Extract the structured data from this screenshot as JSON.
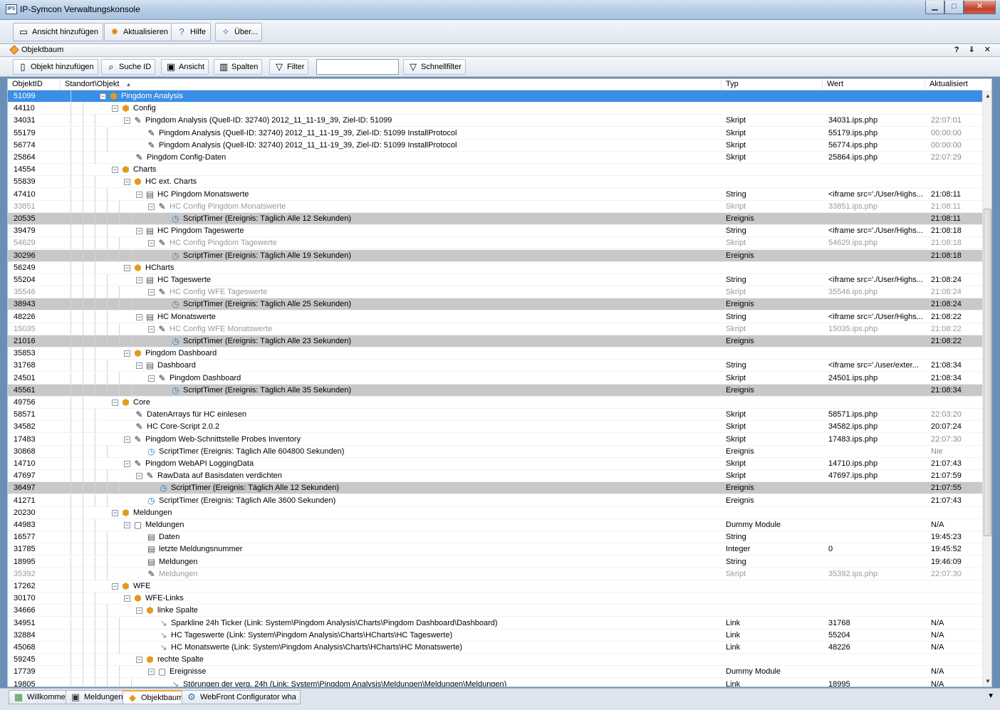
{
  "window": {
    "title": "IP-Symcon Verwaltungskonsole",
    "minimize": "▁",
    "maximize": "□",
    "close": "✕"
  },
  "main_toolbar": {
    "add_view": "Ansicht hinzufügen",
    "refresh": "Aktualisieren",
    "help": "Hilfe",
    "about": "Über..."
  },
  "panel": {
    "title": "Objektbaum",
    "controls": "? ⇓ ✕"
  },
  "tree_toolbar": {
    "add_object": "Objekt hinzufügen",
    "search_id": "Suche ID",
    "view": "Ansicht",
    "columns": "Spalten",
    "filter": "Filter",
    "filter_value": "",
    "quickfilter": "Schnellfilter"
  },
  "columns": {
    "id": "ObjektID",
    "name": "Standort\\Objekt",
    "sort_indicator": "▲",
    "type": "Typ",
    "value": "Wert",
    "updated": "Aktualisiert"
  },
  "rows": [
    {
      "id": "51099",
      "depth": 1,
      "toggle": "⊟",
      "icon": "category",
      "name": "Pingdom Analysis",
      "typ": "",
      "wert": "",
      "akt": "",
      "state": "selected"
    },
    {
      "id": "44110",
      "depth": 2,
      "toggle": "⊟",
      "icon": "category",
      "name": "Config",
      "typ": "",
      "wert": "",
      "akt": ""
    },
    {
      "id": "34031",
      "depth": 3,
      "toggle": "⊟",
      "icon": "script",
      "name": "Pingdom Analysis (Quell-ID: 32740) 2012_11_11-19_39, Ziel-ID: 51099",
      "typ": "Skript",
      "wert": "34031.ips.php",
      "akt": "22:07:01",
      "akt_grey": true
    },
    {
      "id": "55179",
      "depth": 4,
      "toggle": "",
      "icon": "script",
      "name": "Pingdom Analysis (Quell-ID: 32740) 2012_11_11-19_39, Ziel-ID: 51099 InstallProtocol",
      "typ": "Skript",
      "wert": "55179.ips.php",
      "akt": "00:00:00",
      "akt_grey": true
    },
    {
      "id": "56774",
      "depth": 4,
      "toggle": "",
      "icon": "script",
      "name": "Pingdom Analysis (Quell-ID: 32740) 2012_11_11-19_39, Ziel-ID: 51099 InstallProtocol",
      "typ": "Skript",
      "wert": "56774.ips.php",
      "akt": "00:00:00",
      "akt_grey": true
    },
    {
      "id": "25864",
      "depth": 3,
      "toggle": "",
      "icon": "script",
      "name": "Pingdom Config-Daten",
      "typ": "Skript",
      "wert": "25864.ips.php",
      "akt": "22:07:29",
      "akt_grey": true
    },
    {
      "id": "14554",
      "depth": 2,
      "toggle": "⊟",
      "icon": "category",
      "name": "Charts",
      "typ": "",
      "wert": "",
      "akt": ""
    },
    {
      "id": "55839",
      "depth": 3,
      "toggle": "⊟",
      "icon": "category",
      "name": "HC ext. Charts",
      "typ": "",
      "wert": "",
      "akt": ""
    },
    {
      "id": "47410",
      "depth": 4,
      "toggle": "⊟",
      "icon": "variable",
      "name": "HC Pingdom Monatswerte",
      "typ": "String",
      "wert": "<iframe src='./User/Highs...",
      "akt": "21:08:11"
    },
    {
      "id": "33851",
      "depth": 5,
      "toggle": "⊟",
      "icon": "script",
      "name": "HC Config Pingdom Monatswerte",
      "typ": "Skript",
      "wert": "33851.ips.php",
      "akt": "21:08:11",
      "state": "dim"
    },
    {
      "id": "20535",
      "depth": 6,
      "toggle": "",
      "icon": "event",
      "name": "ScriptTimer  (Ereignis: Täglich Alle 12 Sekunden)",
      "typ": "Ereignis",
      "wert": "",
      "akt": "21:08:11",
      "state": "highlight"
    },
    {
      "id": "39479",
      "depth": 4,
      "toggle": "⊟",
      "icon": "variable",
      "name": "HC Pingdom Tageswerte",
      "typ": "String",
      "wert": "<iframe src='./User/Highs...",
      "akt": "21:08:18"
    },
    {
      "id": "54629",
      "depth": 5,
      "toggle": "⊟",
      "icon": "script",
      "name": "HC Config Pingdom Tagewerte",
      "typ": "Skript",
      "wert": "54629.ips.php",
      "akt": "21:08:18",
      "state": "dim"
    },
    {
      "id": "30296",
      "depth": 6,
      "toggle": "",
      "icon": "event",
      "name": "ScriptTimer  (Ereignis: Täglich Alle 19 Sekunden)",
      "typ": "Ereignis",
      "wert": "",
      "akt": "21:08:18",
      "state": "highlight"
    },
    {
      "id": "56249",
      "depth": 3,
      "toggle": "⊟",
      "icon": "category",
      "name": "HCharts",
      "typ": "",
      "wert": "",
      "akt": ""
    },
    {
      "id": "55204",
      "depth": 4,
      "toggle": "⊟",
      "icon": "variable",
      "name": "HC Tageswerte",
      "typ": "String",
      "wert": "<iframe src='./User/Highs...",
      "akt": "21:08:24"
    },
    {
      "id": "35546",
      "depth": 5,
      "toggle": "⊟",
      "icon": "script",
      "name": "HC Config WFE Tageswerte",
      "typ": "Skript",
      "wert": "35546.ips.php",
      "akt": "21:08:24",
      "state": "dim"
    },
    {
      "id": "38943",
      "depth": 6,
      "toggle": "",
      "icon": "event",
      "name": "ScriptTimer  (Ereignis: Täglich Alle 25 Sekunden)",
      "typ": "Ereignis",
      "wert": "",
      "akt": "21:08:24",
      "state": "highlight"
    },
    {
      "id": "48226",
      "depth": 4,
      "toggle": "⊟",
      "icon": "variable",
      "name": "HC Monatswerte",
      "typ": "String",
      "wert": "<iframe src='./User/Highs...",
      "akt": "21:08:22"
    },
    {
      "id": "15035",
      "depth": 5,
      "toggle": "⊟",
      "icon": "script",
      "name": "HC Config WFE Monatswerte",
      "typ": "Skript",
      "wert": "15035.ips.php",
      "akt": "21:08:22",
      "state": "dim"
    },
    {
      "id": "21016",
      "depth": 6,
      "toggle": "",
      "icon": "event",
      "name": "ScriptTimer  (Ereignis: Täglich Alle 23 Sekunden)",
      "typ": "Ereignis",
      "wert": "",
      "akt": "21:08:22",
      "state": "highlight"
    },
    {
      "id": "35853",
      "depth": 3,
      "toggle": "⊟",
      "icon": "category",
      "name": "Pingdom Dashboard",
      "typ": "",
      "wert": "",
      "akt": ""
    },
    {
      "id": "31768",
      "depth": 4,
      "toggle": "⊟",
      "icon": "variable",
      "name": "Dashboard",
      "typ": "String",
      "wert": "<iframe src='./user/exter...",
      "akt": "21:08:34"
    },
    {
      "id": "24501",
      "depth": 5,
      "toggle": "⊟",
      "icon": "script",
      "name": "Pingdom Dashboard",
      "typ": "Skript",
      "wert": "24501.ips.php",
      "akt": "21:08:34"
    },
    {
      "id": "45561",
      "depth": 6,
      "toggle": "",
      "icon": "event",
      "name": "ScriptTimer  (Ereignis: Täglich Alle 35 Sekunden)",
      "typ": "Ereignis",
      "wert": "",
      "akt": "21:08:34",
      "state": "highlight"
    },
    {
      "id": "49756",
      "depth": 2,
      "toggle": "⊟",
      "icon": "category",
      "name": "Core",
      "typ": "",
      "wert": "",
      "akt": ""
    },
    {
      "id": "58571",
      "depth": 3,
      "toggle": "",
      "icon": "script",
      "name": "DatenArrays für HC einlesen",
      "typ": "Skript",
      "wert": "58571.ips.php",
      "akt": "22:03:20",
      "akt_grey": true
    },
    {
      "id": "34582",
      "depth": 3,
      "toggle": "",
      "icon": "script",
      "name": "HC Core-Script 2.0.2",
      "typ": "Skript",
      "wert": "34582.ips.php",
      "akt": "20:07:24"
    },
    {
      "id": "17483",
      "depth": 3,
      "toggle": "⊟",
      "icon": "script",
      "name": "Pingdom Web-Schnittstelle Probes Inventory",
      "typ": "Skript",
      "wert": "17483.ips.php",
      "akt": "22:07:30",
      "akt_grey": true
    },
    {
      "id": "30868",
      "depth": 4,
      "toggle": "",
      "icon": "event",
      "name": "ScriptTimer  (Ereignis: Täglich Alle 604800 Sekunden)",
      "typ": "Ereignis",
      "wert": "",
      "akt": "Nie",
      "akt_grey": true
    },
    {
      "id": "14710",
      "depth": 3,
      "toggle": "⊟",
      "icon": "script",
      "name": "Pingdom WebAPI LoggingData",
      "typ": "Skript",
      "wert": "14710.ips.php",
      "akt": "21:07:43"
    },
    {
      "id": "47697",
      "depth": 4,
      "toggle": "⊟",
      "icon": "script",
      "name": "RawData auf Basisdaten verdichten",
      "typ": "Skript",
      "wert": "47697.ips.php",
      "akt": "21:07:59"
    },
    {
      "id": "36497",
      "depth": 5,
      "toggle": "",
      "icon": "event",
      "name": "ScriptTimer  (Ereignis: Täglich Alle 12 Sekunden)",
      "typ": "Ereignis",
      "wert": "",
      "akt": "21:07:55",
      "state": "highlight"
    },
    {
      "id": "41271",
      "depth": 4,
      "toggle": "",
      "icon": "event",
      "name": "ScriptTimer  (Ereignis: Täglich Alle 3600 Sekunden)",
      "typ": "Ereignis",
      "wert": "",
      "akt": "21:07:43"
    },
    {
      "id": "20230",
      "depth": 2,
      "toggle": "⊟",
      "icon": "category",
      "name": "Meldungen",
      "typ": "",
      "wert": "",
      "akt": ""
    },
    {
      "id": "44983",
      "depth": 3,
      "toggle": "⊟",
      "icon": "module",
      "name": "Meldungen",
      "typ": "Dummy Module",
      "wert": "",
      "akt": "N/A"
    },
    {
      "id": "16577",
      "depth": 4,
      "toggle": "",
      "icon": "variable",
      "name": "Daten",
      "typ": "String",
      "wert": "",
      "akt": "19:45:23"
    },
    {
      "id": "31785",
      "depth": 4,
      "toggle": "",
      "icon": "variable",
      "name": "letzte Meldungsnummer",
      "typ": "Integer",
      "wert": "0",
      "akt": "19:45:52"
    },
    {
      "id": "18995",
      "depth": 4,
      "toggle": "",
      "icon": "variable",
      "name": "Meldungen",
      "typ": "String",
      "wert": "",
      "akt": "19:46:09"
    },
    {
      "id": "35392",
      "depth": 4,
      "toggle": "",
      "icon": "script",
      "name": "Meldungen",
      "typ": "Skript",
      "wert": "35392.ips.php",
      "akt": "22:07:30",
      "state": "dim"
    },
    {
      "id": "17262",
      "depth": 2,
      "toggle": "⊟",
      "icon": "category",
      "name": "WFE",
      "typ": "",
      "wert": "",
      "akt": ""
    },
    {
      "id": "30170",
      "depth": 3,
      "toggle": "⊟",
      "icon": "category",
      "name": "WFE-Links",
      "typ": "",
      "wert": "",
      "akt": ""
    },
    {
      "id": "34666",
      "depth": 4,
      "toggle": "⊟",
      "icon": "category",
      "name": "linke Spalte",
      "typ": "",
      "wert": "",
      "akt": ""
    },
    {
      "id": "34951",
      "depth": 5,
      "toggle": "",
      "icon": "link",
      "name": "Sparkline 24h Ticker (Link: System\\Pingdom Analysis\\Charts\\Pingdom Dashboard\\Dashboard)",
      "typ": "Link",
      "wert": "31768",
      "akt": "N/A"
    },
    {
      "id": "32884",
      "depth": 5,
      "toggle": "",
      "icon": "link",
      "name": "HC Tageswerte (Link: System\\Pingdom Analysis\\Charts\\HCharts\\HC Tageswerte)",
      "typ": "Link",
      "wert": "55204",
      "akt": "N/A"
    },
    {
      "id": "45068",
      "depth": 5,
      "toggle": "",
      "icon": "link",
      "name": "HC Monatswerte (Link: System\\Pingdom Analysis\\Charts\\HCharts\\HC Monatswerte)",
      "typ": "Link",
      "wert": "48226",
      "akt": "N/A"
    },
    {
      "id": "59245",
      "depth": 4,
      "toggle": "⊟",
      "icon": "category",
      "name": "rechte Spalte",
      "typ": "",
      "wert": "",
      "akt": ""
    },
    {
      "id": "17739",
      "depth": 5,
      "toggle": "⊟",
      "icon": "module",
      "name": "Ereignisse",
      "typ": "Dummy Module",
      "wert": "",
      "akt": "N/A"
    },
    {
      "id": "19805",
      "depth": 6,
      "toggle": "",
      "icon": "link",
      "name": "Störungen der verg. 24h (Link: System\\Pingdom Analysis\\Meldungen\\Meldungen\\Meldungen)",
      "typ": "Link",
      "wert": "18995",
      "akt": "N/A"
    }
  ],
  "icons": {
    "category": "⬢",
    "script": "✎",
    "variable": "▤",
    "event": "◷",
    "link": "↘",
    "module": "▢"
  },
  "tabs": [
    {
      "label": "Willkommen",
      "icon": "▦"
    },
    {
      "label": "Meldungen",
      "icon": "▣"
    },
    {
      "label": "Objektbaum",
      "icon": "◆",
      "active": true
    },
    {
      "label": "WebFront Configurator wha",
      "icon": "⚙"
    }
  ],
  "tab_more": "▼",
  "colors": {
    "selection": "#3a8ee6",
    "highlight_row": "#c8c8c8",
    "category_icon": "#e29a1b"
  }
}
